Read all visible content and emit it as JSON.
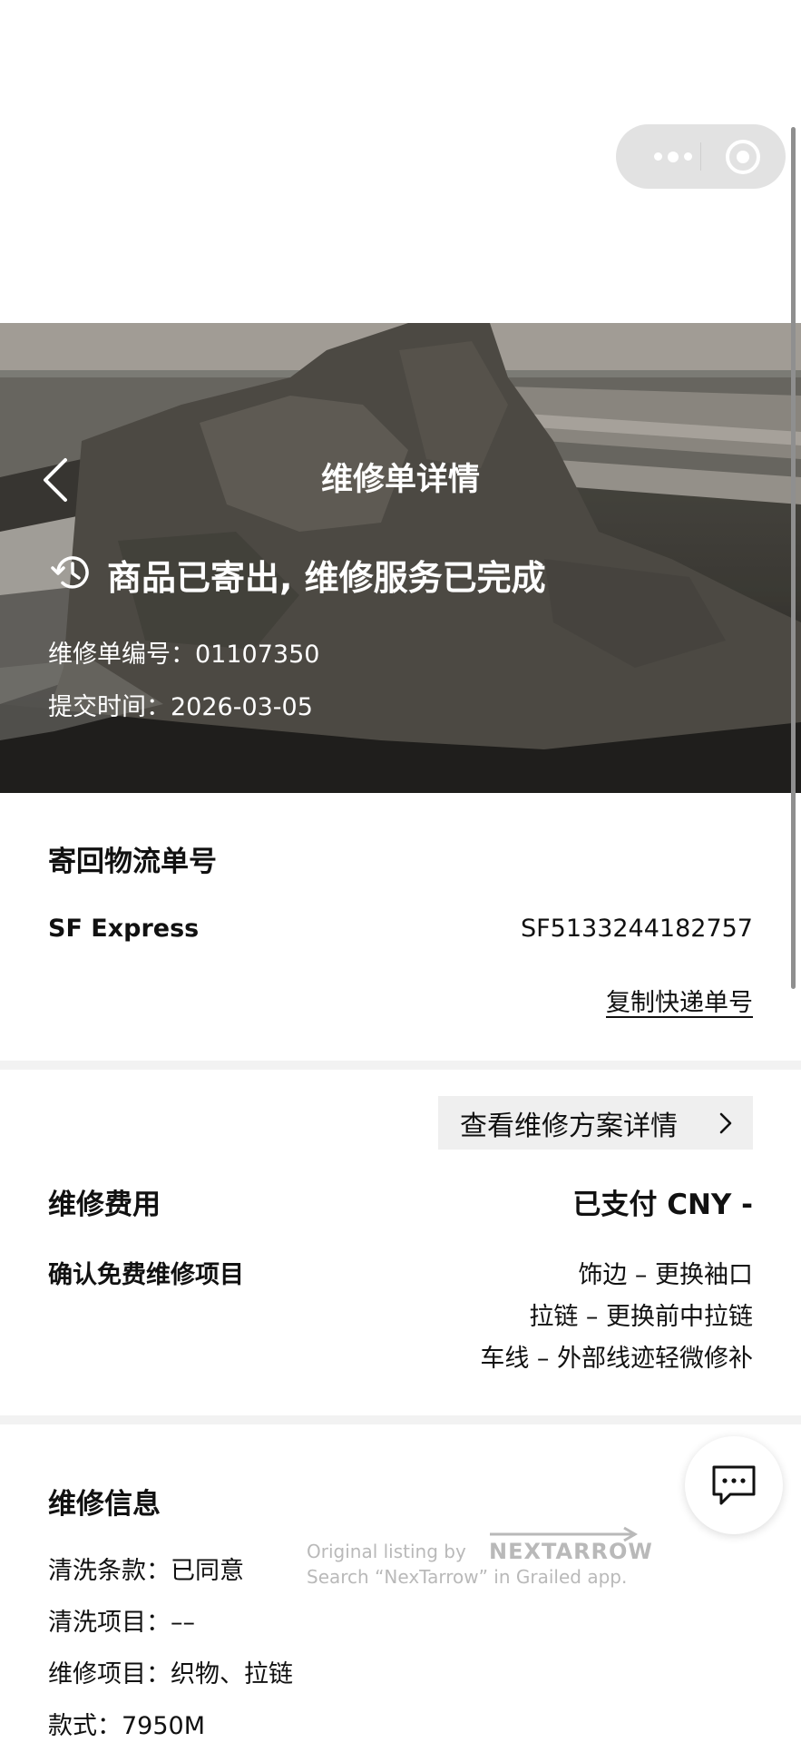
{
  "header": {
    "title": "维修单详情",
    "status": "商品已寄出, 维修服务已完成",
    "order_no_label": "维修单编号：",
    "order_no": "01107350",
    "submit_label": "提交时间：",
    "submit_date": "2026-03-05"
  },
  "logistics": {
    "title": "寄回物流单号",
    "carrier": "SF Express",
    "tracking_no": "SF5133244182757",
    "copy_label": "复制快递单号"
  },
  "fees": {
    "plan_button_label": "查看维修方案详情",
    "title": "维修费用",
    "payment": "已支付 CNY -",
    "free_items_label": "确认免费维修项目",
    "free_items": [
      "饰边 – 更换袖口",
      "拉链 – 更换前中拉链",
      "车线 – 外部线迹轻微修补"
    ]
  },
  "repair_info": {
    "title": "维修信息",
    "rows": [
      {
        "label": "清洗条款：",
        "value": "已同意"
      },
      {
        "label": "清洗项目：",
        "value": "––"
      },
      {
        "label": "维修项目：",
        "value": "织物、拉链"
      },
      {
        "label": "款式：",
        "value": "7950M"
      }
    ]
  },
  "watermark": {
    "line1": "Original listing by",
    "brand": "NEXTARROW",
    "line2": "Search “NexTarrow” in Grailed app."
  },
  "icons": {
    "back": "chevron-left-icon",
    "status": "history-clock-icon",
    "plan": "chevron-right-icon",
    "chat": "chat-bubble-icon",
    "more": "more-dots-icon",
    "close_miniapp": "target-circle-icon"
  }
}
